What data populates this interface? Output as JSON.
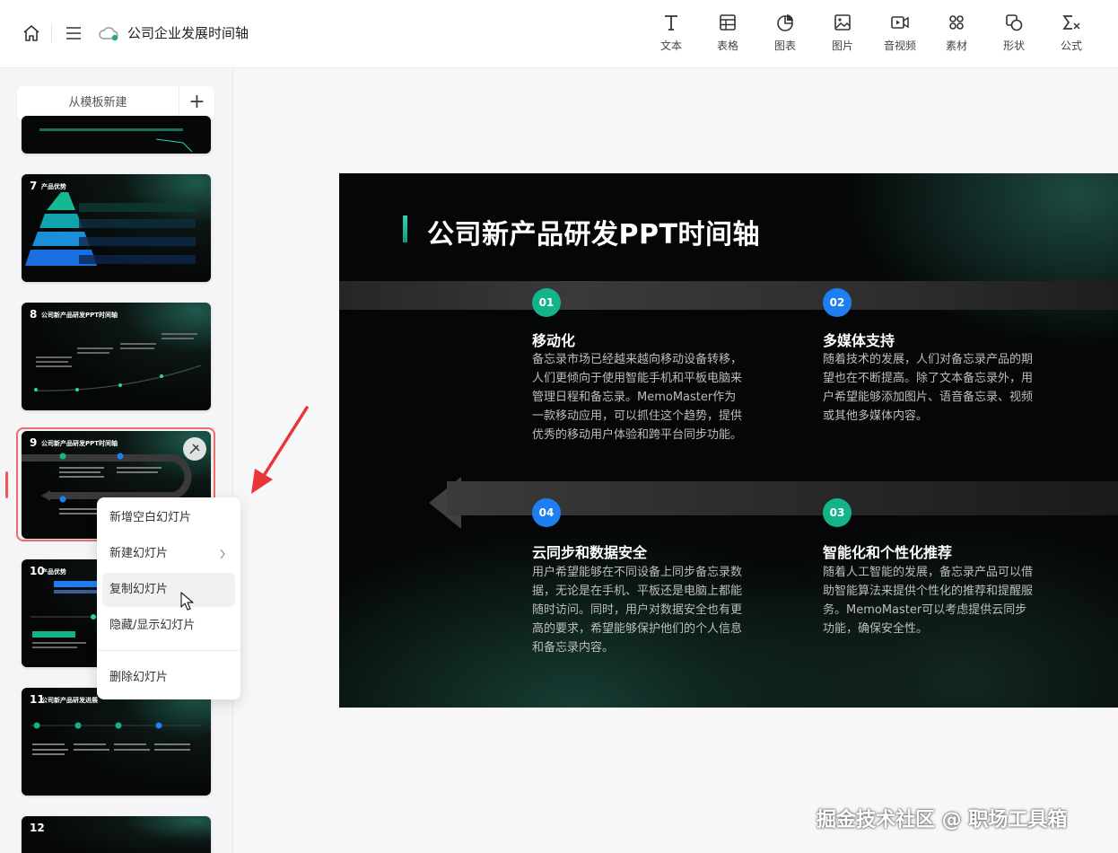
{
  "topbar": {
    "doc_title": "公司企业发展时间轴",
    "tools": [
      {
        "label": "文本",
        "icon": "text-icon"
      },
      {
        "label": "表格",
        "icon": "table-icon"
      },
      {
        "label": "图表",
        "icon": "chart-icon"
      },
      {
        "label": "图片",
        "icon": "image-icon"
      },
      {
        "label": "音视频",
        "icon": "video-icon"
      },
      {
        "label": "素材",
        "icon": "material-icon"
      },
      {
        "label": "形状",
        "icon": "shape-icon"
      },
      {
        "label": "公式",
        "icon": "formula-icon"
      }
    ]
  },
  "sidebar": {
    "new_from_template": "从模板新建",
    "add": "+",
    "slides": [
      {
        "num": "7",
        "title": "产品优势"
      },
      {
        "num": "8",
        "title": "公司新产品研发PPT时间轴"
      },
      {
        "num": "9",
        "title": "公司新产品研发PPT时间轴",
        "selected": true
      },
      {
        "num": "10",
        "title": "产品优势"
      },
      {
        "num": "11",
        "title": "公司新产品研发进展"
      },
      {
        "num": "12",
        "title": ""
      }
    ]
  },
  "context_menu": {
    "items": [
      {
        "label": "新增空白幻灯片"
      },
      {
        "label": "新建幻灯片",
        "has_submenu": true
      },
      {
        "label": "复制幻灯片",
        "hovered": true
      },
      {
        "label": "隐藏/显示幻灯片"
      },
      {
        "label": "删除幻灯片"
      }
    ]
  },
  "slide": {
    "title": "公司新产品研发PPT时间轴",
    "items": [
      {
        "num": "01",
        "heading": "移动化",
        "text": "备忘录市场已经越来越向移动设备转移，人们更倾向于使用智能手机和平板电脑来管理日程和备忘录。MemoMaster作为一款移动应用，可以抓住这个趋势，提供优秀的移动用户体验和跨平台同步功能。"
      },
      {
        "num": "02",
        "heading": "多媒体支持",
        "text": "随着技术的发展，人们对备忘录产品的期望也在不断提高。除了文本备忘录外，用户希望能够添加图片、语音备忘录、视频或其他多媒体内容。"
      },
      {
        "num": "04",
        "heading": "云同步和数据安全",
        "text": "用户希望能够在不同设备上同步备忘录数据，无论是在手机、平板还是电脑上都能随时访问。同时，用户对数据安全也有更高的要求，希望能够保护他们的个人信息和备忘录内容。"
      },
      {
        "num": "03",
        "heading": "智能化和个性化推荐",
        "text": "随着人工智能的发展，备忘录产品可以借助智能算法来提供个性化的推荐和提醒服务。MemoMaster可以考虑提供云同步功能，确保安全性。"
      }
    ]
  },
  "watermark": "掘金技术社区 @ 职场工具箱",
  "colors": {
    "accent_green": "#13b48a",
    "accent_blue": "#1f7ff2",
    "selection_red": "#f06b6b"
  }
}
